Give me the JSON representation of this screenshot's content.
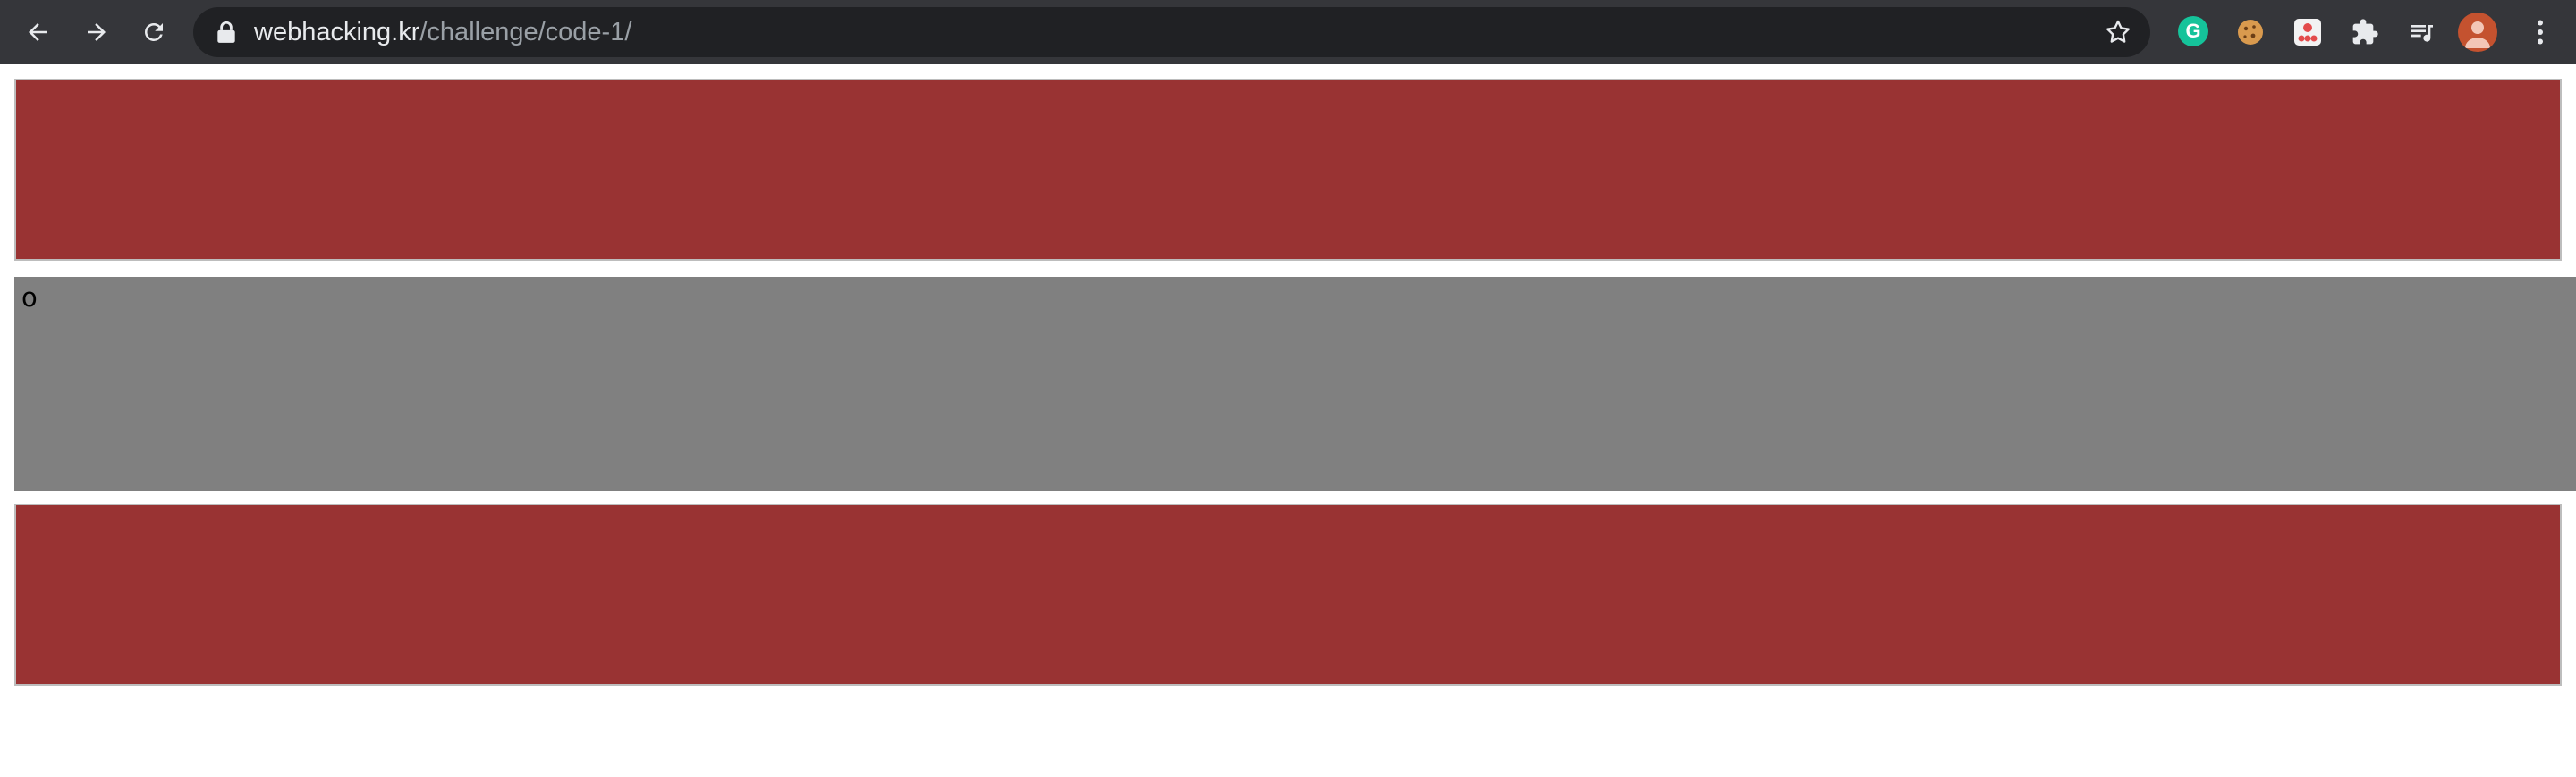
{
  "browser": {
    "url_host": "webhacking.kr",
    "url_path": "/challenge/code-1/",
    "icons": {
      "back": "arrow-left-icon",
      "forward": "arrow-right-icon",
      "reload": "reload-icon",
      "lock": "lock-icon",
      "bookmark": "star-icon",
      "extensions": [
        "grammarly-icon",
        "cookie-icon",
        "red-extension-icon",
        "puzzle-icon",
        "playlist-icon"
      ],
      "profile": "avatar-icon",
      "menu": "more-vertical-icon"
    },
    "grammarly_letter": "G"
  },
  "page": {
    "frame_middle_text": "o"
  },
  "colors": {
    "toolbar": "#35363a",
    "omnibox": "#202124",
    "frame_red": "#993333",
    "frame_gray": "#808080"
  }
}
